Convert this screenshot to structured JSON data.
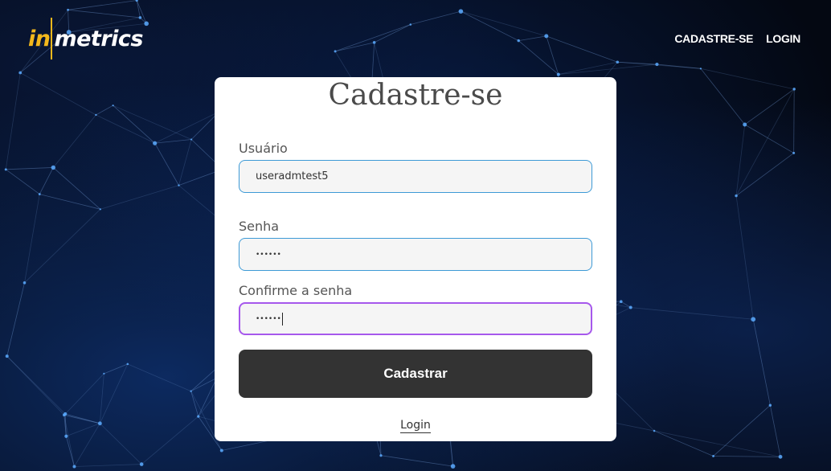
{
  "header": {
    "logo": {
      "part1": "in",
      "part2": "metrics"
    },
    "nav": [
      {
        "label": "CADASTRE-SE"
      },
      {
        "label": "LOGIN"
      }
    ]
  },
  "form": {
    "title": "Cadastre-se",
    "username": {
      "label": "Usuário",
      "value": "useradmtest5"
    },
    "password": {
      "label": "Senha",
      "value": "••••••"
    },
    "confirm_password": {
      "label": "Confirme a senha",
      "value": "••••••"
    },
    "submit_label": "Cadastrar",
    "login_link": "Login"
  },
  "colors": {
    "brand_yellow": "#f3b81c",
    "input_border": "#3d9ad6",
    "focus_border": "#a658ec",
    "button_bg": "#333333"
  }
}
